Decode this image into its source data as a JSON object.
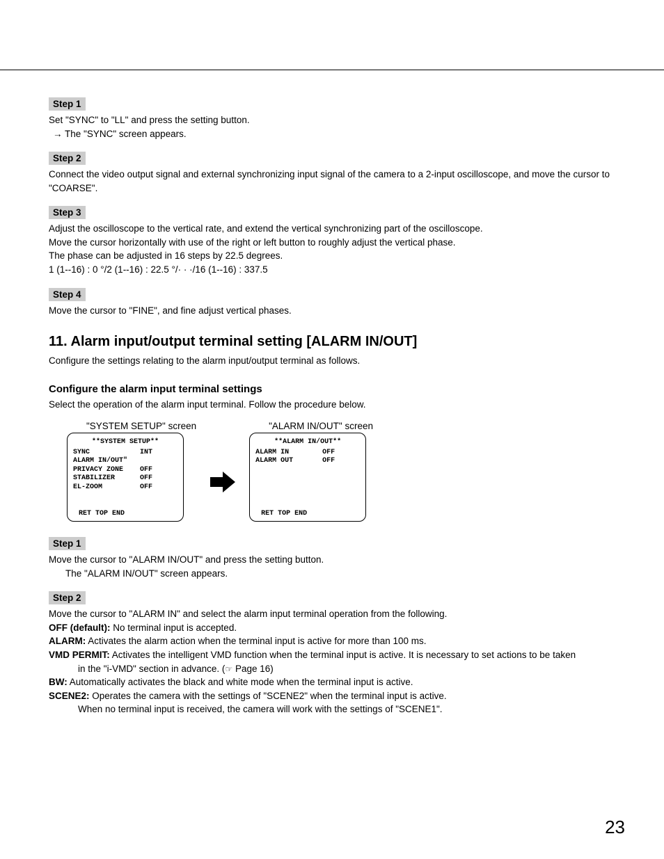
{
  "steps_a": {
    "s1": {
      "label": "Step 1",
      "l1": "Set \"SYNC\" to \"LL\" and press the setting button.",
      "l2": "The \"SYNC\" screen appears."
    },
    "s2": {
      "label": "Step 2",
      "l1": "Connect the video output signal and external synchronizing input signal of the camera to a 2-input oscilloscope, and move the cursor to \"COARSE\"."
    },
    "s3": {
      "label": "Step 3",
      "l1": "Adjust the oscilloscope to the vertical rate, and extend the vertical synchronizing part of the oscilloscope.",
      "l2": "Move the cursor horizontally with use of the right or left button to roughly adjust the vertical phase.",
      "l3": "The phase can be adjusted in 16 steps by 22.5 degrees.",
      "l4": "1 (1--16) : 0 °/2 (1--16) : 22.5 °/· · ·/16 (1--16) : 337.5"
    },
    "s4": {
      "label": "Step 4",
      "l1": "Move the cursor to \"FINE\", and fine adjust vertical phases."
    }
  },
  "section11": {
    "title": "11. Alarm input/output terminal setting [ALARM IN/OUT]",
    "intro": "Configure the settings relating to the alarm input/output terminal as follows.",
    "sub": "Configure the alarm input terminal settings",
    "sub_intro": "Select the operation of the alarm input terminal. Follow the procedure below."
  },
  "screens": {
    "left": {
      "label": "\"SYSTEM SETUP\" screen",
      "title": "**SYSTEM SETUP**",
      "rows": [
        "SYNC            INT",
        "ALARM IN/OUT\"",
        "",
        "PRIVACY ZONE    OFF",
        "STABILIZER      OFF",
        "EL-ZOOM         OFF"
      ],
      "footer": "RET TOP END"
    },
    "right": {
      "label": "\"ALARM IN/OUT\" screen",
      "title": "**ALARM IN/OUT**",
      "rows": [
        "",
        "ALARM IN        OFF",
        "ALARM OUT       OFF"
      ],
      "footer": "RET TOP END"
    }
  },
  "steps_b": {
    "s1": {
      "label": "Step 1",
      "l1": "Move the cursor to \"ALARM IN/OUT\" and press the setting button.",
      "l2": "The \"ALARM IN/OUT\" screen appears."
    },
    "s2": {
      "label": "Step 2",
      "intro": "Move the cursor to \"ALARM IN\" and select the alarm input terminal operation from the following.",
      "defs": {
        "off": {
          "term": "OFF (default):",
          "text": " No terminal input is accepted."
        },
        "alarm": {
          "term": "ALARM:",
          "text": " Activates the alarm action when the terminal input is active for more than 100 ms."
        },
        "vmd": {
          "term": "VMD PERMIT:",
          "text": " Activates the intelligent VMD function when the terminal input is active. It is necessary to set actions to be taken",
          "cont": "in the \"i-VMD\" section in advance. (",
          "page": " Page 16)"
        },
        "bw": {
          "term": "BW:",
          "text": " Automatically activates the black and white mode when the terminal input is active."
        },
        "scene2": {
          "term": "SCENE2:",
          "text": " Operates the camera with the settings of \"SCENE2\" when the terminal input is active.",
          "cont": "When no terminal input is received, the camera will work with the settings of \"SCENE1\"."
        }
      }
    }
  },
  "page_number": "23"
}
